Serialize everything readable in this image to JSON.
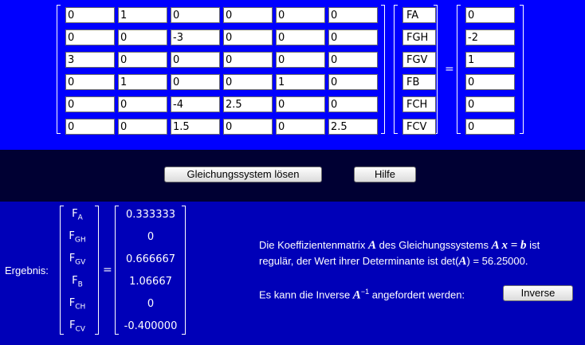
{
  "matrix": [
    [
      "0",
      "1",
      "0",
      "0",
      "0",
      "0"
    ],
    [
      "0",
      "0",
      "-3",
      "0",
      "0",
      "0"
    ],
    [
      "3",
      "0",
      "0",
      "0",
      "0",
      "0"
    ],
    [
      "0",
      "1",
      "0",
      "0",
      "1",
      "0"
    ],
    [
      "0",
      "0",
      "-4",
      "2.5",
      "0",
      "0"
    ],
    [
      "0",
      "0",
      "1.5",
      "0",
      "0",
      "2.5"
    ]
  ],
  "variables": [
    "FA",
    "FGH",
    "FGV",
    "FB",
    "FCH",
    "FCV"
  ],
  "equals": "=",
  "rhs": [
    "0",
    "-2",
    "1",
    "0",
    "0",
    "0"
  ],
  "buttons": {
    "solve": "Gleichungssystem lösen",
    "help": "Hilfe",
    "inverse": "Inverse"
  },
  "result": {
    "label": "Ergebnis:",
    "symbols": [
      {
        "base": "F",
        "sub": "A"
      },
      {
        "base": "F",
        "sub": "GH"
      },
      {
        "base": "F",
        "sub": "GV"
      },
      {
        "base": "F",
        "sub": "B"
      },
      {
        "base": "F",
        "sub": "CH"
      },
      {
        "base": "F",
        "sub": "CV"
      }
    ],
    "values": [
      "0.333333",
      "0",
      "0.666667",
      "1.06667",
      "0",
      "-0.400000"
    ],
    "equals": "="
  },
  "message": {
    "line1_a": "Die Koeffizientenmatrix ",
    "A": "A",
    "line1_b": " des Gleichungssystems ",
    "eq": "A x = b",
    "line1_c": " ist",
    "line2_a": "regulär, der Wert ihrer Determinante ist det(",
    "line2_b": ") = 56.25000.",
    "line3_a": "Es kann die Inverse ",
    "inv_sup": "−1",
    "line3_b": " angefordert werden:"
  }
}
